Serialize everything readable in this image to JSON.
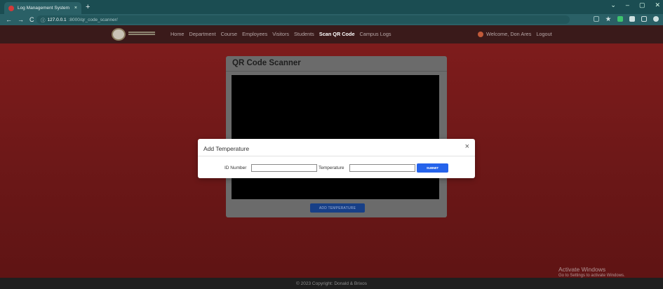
{
  "browser": {
    "tab_title": "Log Management System",
    "tab_close": "×",
    "new_tab": "+",
    "url_host": "127.0.0.1",
    "url_path": ":8000/qr_code_scanner/",
    "url_icon": "ⓘ",
    "back": "←",
    "forward": "→",
    "reload": "C",
    "win_controls": [
      "⌄",
      "–",
      "▢",
      "✕"
    ]
  },
  "navbar": {
    "menu": [
      "Home",
      "Department",
      "Course",
      "Employees",
      "Visitors",
      "Students",
      "Scan QR Code",
      "Campus Logs"
    ],
    "active": "Scan QR Code",
    "welcome": "Welcome, Don Ares",
    "logout": "Logout"
  },
  "card": {
    "title": "QR Code Scanner",
    "add_temperature_button": "ADD TEMPERATURE"
  },
  "modal": {
    "title": "Add Temperature",
    "close": "×",
    "id_label": "ID Number",
    "id_value": "",
    "temp_label": "Temperature",
    "temp_value": "",
    "submit": "SUBMIT"
  },
  "footer": {
    "text": "© 2023 Copyright: Donald & Brixos"
  },
  "watermark": {
    "line1": "Activate Windows",
    "line2": "Go to Settings to activate Windows."
  },
  "colors": {
    "tabbar": "#1b4d52",
    "navbar": "#3a1a1a",
    "page": "#7e1c1c",
    "submit": "#2563eb",
    "add_temp": "#173f87"
  }
}
